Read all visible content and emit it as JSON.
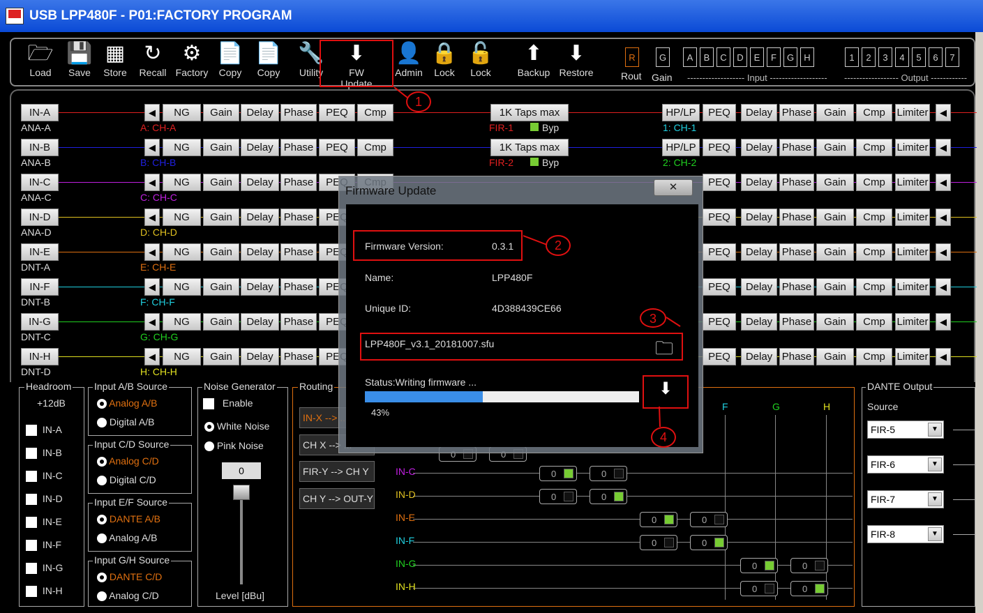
{
  "window": {
    "title": "USB LPP480F - P01:FACTORY PROGRAM"
  },
  "toolbar": {
    "items": [
      {
        "label": "Load",
        "icon": "folder-icon"
      },
      {
        "label": "Save",
        "icon": "floppy-icon"
      },
      {
        "label": "Store",
        "icon": "chip-icon"
      },
      {
        "label": "Recall",
        "icon": "refresh-icon"
      },
      {
        "label": "Factory",
        "icon": "factory-icon"
      },
      {
        "label": "Copy",
        "icon": "copy-in-icon"
      },
      {
        "label": "Copy",
        "icon": "copy-out-icon"
      },
      {
        "label": "Utility",
        "icon": "wrench-icon"
      },
      {
        "label": "FW Update",
        "icon": "iap-chip-icon"
      },
      {
        "label": "Admin",
        "icon": "admin-icon"
      },
      {
        "label": "Lock",
        "icon": "lock-closed-icon"
      },
      {
        "label": "Lock",
        "icon": "lock-open-icon"
      },
      {
        "label": "Backup",
        "icon": "upload-icon"
      },
      {
        "label": "Restore",
        "icon": "download-icon"
      }
    ],
    "rout_gain": {
      "r": "R",
      "g": "G",
      "rout": "Rout",
      "gain": "Gain"
    },
    "inputs": [
      "A",
      "B",
      "C",
      "D",
      "E",
      "F",
      "G",
      "H"
    ],
    "outputs": [
      "1",
      "2",
      "3",
      "4",
      "5",
      "6",
      "7"
    ],
    "input_label": "------------------- Input -------------------",
    "output_label": "------------------ Output ------------"
  },
  "channels": [
    {
      "in": "IN-A",
      "src": "ANA-A",
      "name": "A: CH-A",
      "color": "#e02020",
      "out": "1: CH-1"
    },
    {
      "in": "IN-B",
      "src": "ANA-B",
      "name": "B: CH-B",
      "color": "#2020e0",
      "out": "2: CH-2"
    },
    {
      "in": "IN-C",
      "src": "ANA-C",
      "name": "C: CH-C",
      "color": "#c020e0"
    },
    {
      "in": "IN-D",
      "src": "ANA-D",
      "name": "D: CH-D",
      "color": "#e0c020"
    },
    {
      "in": "IN-E",
      "src": "DNT-A",
      "name": "E: CH-E",
      "color": "#e07010"
    },
    {
      "in": "IN-F",
      "src": "DNT-B",
      "name": "F: CH-F",
      "color": "#20d0e0"
    },
    {
      "in": "IN-G",
      "src": "DNT-C",
      "name": "G: CH-G",
      "color": "#20d020"
    },
    {
      "in": "IN-H",
      "src": "DNT-D",
      "name": "H: CH-H",
      "color": "#e0e020"
    }
  ],
  "proc_buttons": [
    "NG",
    "Gain",
    "Delay",
    "Phase",
    "PEQ",
    "Cmp"
  ],
  "fir": {
    "taps": "1K Taps max",
    "fir1": "FIR-1",
    "fir2": "FIR-2",
    "byp": "Byp"
  },
  "out_buttons": [
    "HP/LP",
    "PEQ",
    "Delay",
    "Phase",
    "Gain",
    "Cmp",
    "Limiter"
  ],
  "headroom": {
    "title": "Headroom",
    "value": "+12dB",
    "items": [
      "IN-A",
      "IN-B",
      "IN-C",
      "IN-D",
      "IN-E",
      "IN-F",
      "IN-G",
      "IN-H"
    ]
  },
  "source_groups": [
    {
      "title": "Input A/B Source",
      "opt1": "Analog A/B",
      "opt2": "Digital A/B"
    },
    {
      "title": "Input C/D Source",
      "opt1": "Analog C/D",
      "opt2": "Digital C/D"
    },
    {
      "title": "Input E/F Source",
      "opt1": "DANTE A/B",
      "opt2": "Analog A/B"
    },
    {
      "title": "Input G/H Source",
      "opt1": "DANTE C/D",
      "opt2": "Analog C/D"
    }
  ],
  "noise": {
    "title": "Noise Generator",
    "enable": "Enable",
    "white": "White Noise",
    "pink": "Pink Noise",
    "level_value": "0",
    "level_label": "Level [dBu]"
  },
  "routing": {
    "title": "Routing",
    "btns": [
      "IN-X --> ...",
      "CH X --> ...",
      "FIR-Y --> CH Y",
      "CH Y --> OUT-Y"
    ],
    "rows": [
      "IN-C",
      "IN-D",
      "IN-E",
      "IN-F",
      "IN-G",
      "IN-H"
    ],
    "cols": [
      "F",
      "G",
      "H"
    ],
    "cell": "0"
  },
  "dante": {
    "title": "DANTE Output",
    "source": "Source",
    "sel": [
      "FIR-5",
      "FIR-6",
      "FIR-7",
      "FIR-8"
    ]
  },
  "dialog": {
    "title": "Firmware Update",
    "close": "✕",
    "version_label": "Firmware Version:",
    "version": "0.3.1",
    "name_label": "Name:",
    "name": "LPP480F",
    "uid_label": "Unique ID:",
    "uid": "4D388439CE66",
    "file": "LPP480F_v3.1_20181007.sfu",
    "status": "Status:Writing firmware ...",
    "progress": 0.43,
    "progress_text": "43%"
  },
  "callouts": [
    "1",
    "2",
    "3",
    "4"
  ],
  "colors": {
    "accent": "#e01010",
    "progress": "#3a8ee8"
  }
}
